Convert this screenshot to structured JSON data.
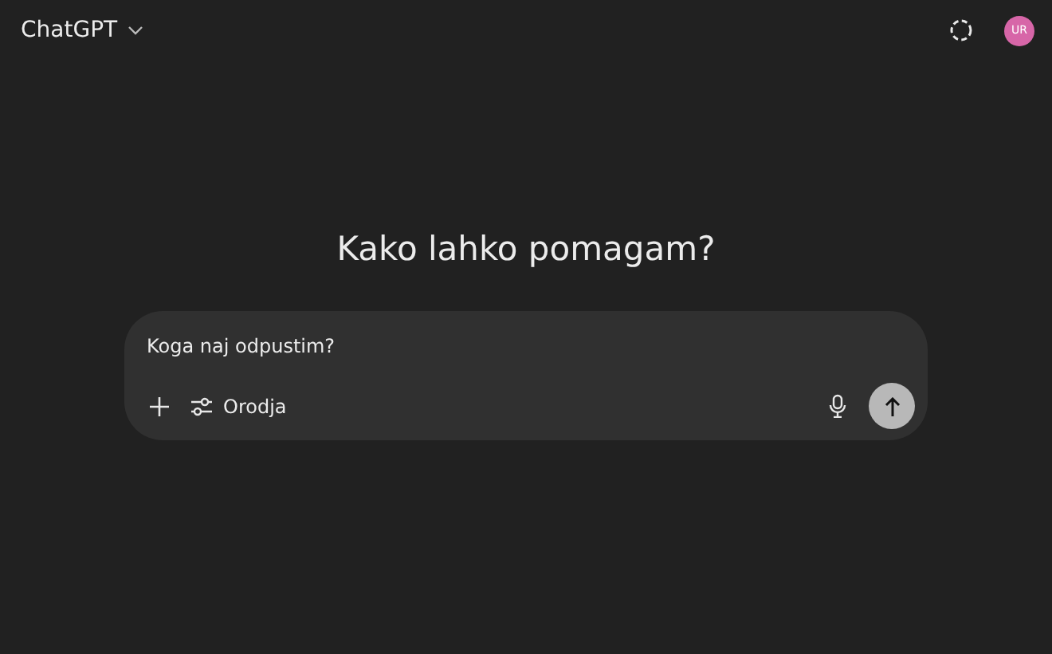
{
  "header": {
    "title": "ChatGPT",
    "avatar": "UR"
  },
  "heading": "Kako lahko pomagam?",
  "composer": {
    "value": "Koga naj odpustim?",
    "tools_label": "Orodja"
  }
}
